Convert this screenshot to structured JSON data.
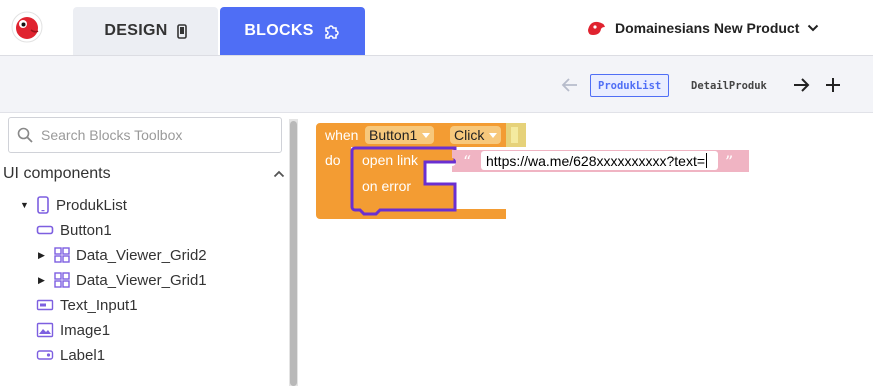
{
  "topbar": {
    "tabs": [
      {
        "label": "DESIGN",
        "icon": "phone-icon",
        "active": false
      },
      {
        "label": "BLOCKS",
        "icon": "puzzle-icon",
        "active": true
      }
    ],
    "project_name": "Domainesians New Product",
    "accent_color": "#4f6ef5"
  },
  "screens": {
    "active": "ProdukList",
    "other": "DetailProduk"
  },
  "toolbox": {
    "search_placeholder": "Search Blocks Toolbox",
    "section_title": "UI components",
    "items": [
      {
        "label": "ProdukList",
        "icon": "phone-icon",
        "expanded": true
      },
      {
        "label": "Button1",
        "icon": "button-icon"
      },
      {
        "label": "Data_Viewer_Grid2",
        "icon": "grid-icon",
        "collapsed": true
      },
      {
        "label": "Data_Viewer_Grid1",
        "icon": "grid-icon",
        "collapsed": true
      },
      {
        "label": "Text_Input1",
        "icon": "text-input-icon"
      },
      {
        "label": "Image1",
        "icon": "image-icon"
      },
      {
        "label": "Label1",
        "icon": "label-icon"
      }
    ]
  },
  "blocks": {
    "when_label": "when",
    "component": "Button1",
    "event": "Click",
    "do_label": "do",
    "open_link_label": "open link",
    "on_error_label": "on error",
    "url_value": "https://wa.me/628xxxxxxxxxx?text=",
    "event_color": "#f39c33",
    "action_color": "#f39c33",
    "action_outline": "#6a2fd1",
    "text_block_color": "#f0b4c3"
  }
}
